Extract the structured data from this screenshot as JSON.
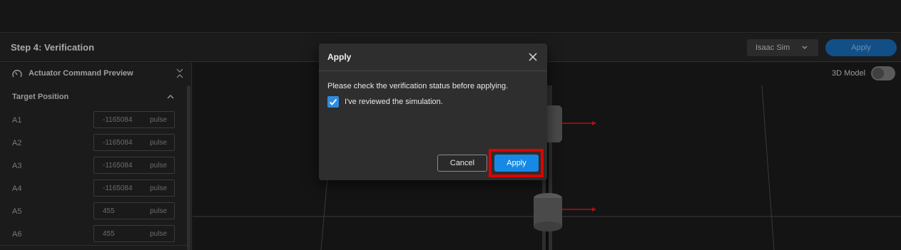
{
  "header": {
    "title": "Step 4: Verification",
    "simulator_select": "Isaac Sim",
    "apply_label": "Apply"
  },
  "sidebar": {
    "panel_title": "Actuator Command Preview",
    "section_title": "Target Position",
    "rows": [
      {
        "label": "A1",
        "value": "-1165084",
        "unit": "pulse"
      },
      {
        "label": "A2",
        "value": "-1165084",
        "unit": "pulse"
      },
      {
        "label": "A3",
        "value": "-1165084",
        "unit": "pulse"
      },
      {
        "label": "A4",
        "value": "-1165084",
        "unit": "pulse"
      },
      {
        "label": "A5",
        "value": "455",
        "unit": "pulse"
      },
      {
        "label": "A6",
        "value": "455",
        "unit": "pulse"
      }
    ]
  },
  "viewport": {
    "model_toggle_label": "3D Model",
    "model_toggle_on": false
  },
  "dialog": {
    "title": "Apply",
    "message": "Please check the verification status before applying.",
    "checkbox_label": "I've reviewed the simulation.",
    "checkbox_checked": true,
    "cancel_label": "Cancel",
    "apply_label": "Apply"
  },
  "colors": {
    "accent": "#1688e6",
    "highlight": "#e00000",
    "arrow": "#b01010"
  }
}
